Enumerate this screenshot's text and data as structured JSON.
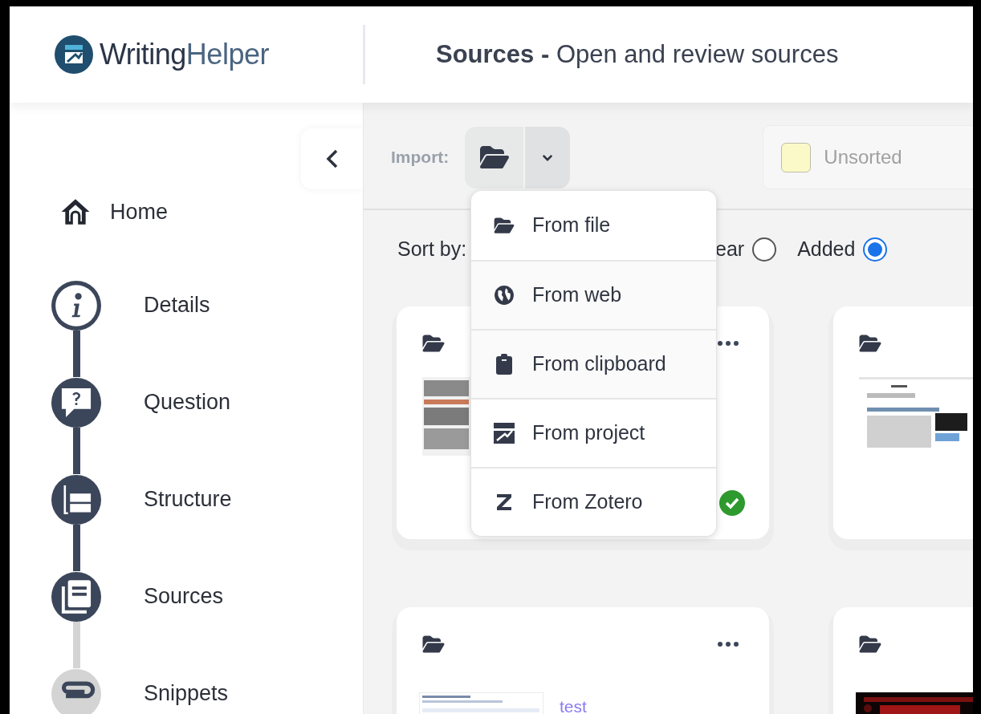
{
  "header": {
    "logo_word_1": "Writing",
    "logo_word_2": "Helper",
    "title": "**Sources -** Open and review sources"
  },
  "sidebar": {
    "home": "Home",
    "steps": [
      {
        "label": "Details",
        "done": true
      },
      {
        "label": "Question",
        "done": true
      },
      {
        "label": "Structure",
        "done": true
      },
      {
        "label": "Sources",
        "done": true
      },
      {
        "label": "Snippets",
        "done": false
      }
    ]
  },
  "toolbar": {
    "import_label": "Import:",
    "filter": {
      "label": "Unsorted"
    }
  },
  "sort": {
    "label": "Sort by:",
    "options": [
      {
        "label": "ear",
        "selected": false
      },
      {
        "label": "Added",
        "selected": true
      }
    ]
  },
  "import_menu": {
    "items": [
      {
        "label": "From file"
      },
      {
        "label": "From web"
      },
      {
        "label": "From clipboard"
      },
      {
        "label": "From project"
      },
      {
        "label": "From Zotero"
      }
    ]
  },
  "cards": [
    {
      "verified": true
    },
    {
      "verified": false
    },
    {
      "title": "test",
      "verified": false
    },
    {
      "verified": false
    }
  ]
}
